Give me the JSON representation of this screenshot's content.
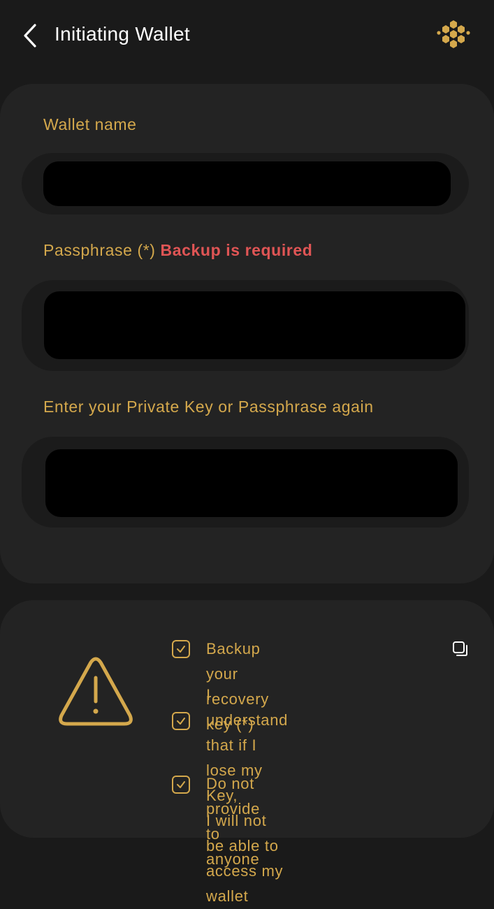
{
  "header": {
    "title": "Initiating Wallet",
    "back_icon": "chevron-left-icon",
    "logo_icon": "hexagon-cluster-logo"
  },
  "form": {
    "wallet_name": {
      "label": "Wallet name",
      "value": ""
    },
    "passphrase": {
      "label": "Passphrase (*)",
      "required_note": "Backup is required",
      "value": ""
    },
    "confirm": {
      "label": "Enter your Private Key or Passphrase again",
      "value": ""
    }
  },
  "warning": {
    "icon": "warning-triangle-icon",
    "items": [
      {
        "text": "Backup your recovery key (*)",
        "checked": true
      },
      {
        "line1": "I understand that if I lose my Key,",
        "line2": "I will not be able to access my",
        "line3": "wallet",
        "checked": true
      },
      {
        "text": "Do not provide to anyone",
        "checked": true
      }
    ],
    "copy_icon": "copy-icon"
  },
  "colors": {
    "accent": "#d4a84c",
    "error": "#e05555",
    "background": "#1a1a1a",
    "card": "#232323"
  }
}
